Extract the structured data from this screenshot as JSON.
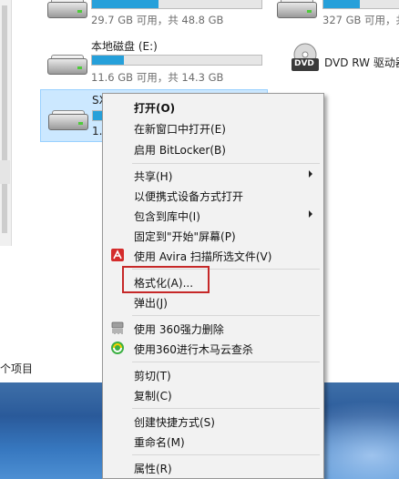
{
  "drives": {
    "top_left": {
      "info": "29.7 GB 可用，共 48.8 GB",
      "usage_fraction": 0.39
    },
    "top_right": {
      "info": "327 GB 可用，共",
      "usage_fraction": 0.45
    },
    "e_drive": {
      "name": "本地磁盘 (E:)",
      "info": "11.6 GB 可用，共 14.3 GB",
      "usage_fraction": 0.19
    },
    "dvd": {
      "name": "DVD RW 驱动器",
      "icon_label": "DVD"
    },
    "usb": {
      "name": "SX",
      "info": "1."
    }
  },
  "status_bar": {
    "items": "个项目"
  },
  "context_menu": {
    "items": [
      {
        "label": "打开(O)"
      },
      {
        "label": "在新窗口中打开(E)"
      },
      {
        "label": "启用 BitLocker(B)"
      },
      {
        "label": "共享(H)"
      },
      {
        "label": "以便携式设备方式打开"
      },
      {
        "label": "包含到库中(I)"
      },
      {
        "label": "固定到\"开始\"屏幕(P)"
      },
      {
        "label": "使用 Avira 扫描所选文件(V)"
      },
      {
        "label": "格式化(A)..."
      },
      {
        "label": "弹出(J)"
      },
      {
        "label": "使用 360强力删除"
      },
      {
        "label": "使用360进行木马云查杀"
      },
      {
        "label": "剪切(T)"
      },
      {
        "label": "复制(C)"
      },
      {
        "label": "创建快捷方式(S)"
      },
      {
        "label": "重命名(M)"
      },
      {
        "label": "属性(R)"
      }
    ]
  },
  "colors": {
    "usage_bar": "#26a0da",
    "selection": "#cce8ff",
    "highlight_box": "#c62828",
    "avira_red": "#d42b2b"
  },
  "icons": [
    "hard-drive-icon",
    "dvd-drive-icon",
    "usb-drive-icon",
    "avira-icon",
    "shredder-icon",
    "360-safe-icon",
    "submenu-arrow-icon"
  ]
}
